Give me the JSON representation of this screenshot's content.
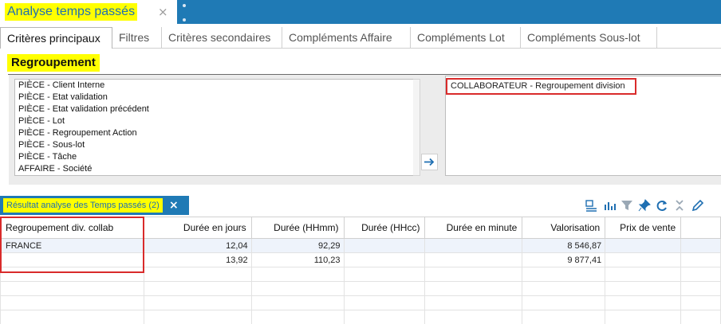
{
  "window": {
    "title": "Analyse temps passés",
    "close_glyph": "×"
  },
  "tabs": [
    {
      "label": "Critères principaux",
      "active": true
    },
    {
      "label": "Filtres"
    },
    {
      "label": "Critères secondaires"
    },
    {
      "label": "Compléments Affaire"
    },
    {
      "label": "Compléments Lot"
    },
    {
      "label": "Compléments Sous-lot"
    }
  ],
  "regroupement": {
    "title": "Regroupement",
    "available": [
      "PIÈCE - Client Interne",
      "PIÈCE - Etat validation",
      "PIÈCE - Etat validation précédent",
      "PIÈCE - Lot",
      "PIÈCE - Regroupement Action",
      "PIÈCE - Sous-lot",
      "PIÈCE - Tâche",
      "AFFAIRE - Société"
    ],
    "selected": [
      "COLLABORATEUR - Regroupement division"
    ],
    "move_button_icon": "arrow-right-icon"
  },
  "result": {
    "tab_label": "Résultat analyse des Temps passés (2)",
    "close_glyph": "×",
    "toolbar_icons": [
      "columns-icon",
      "chart-icon",
      "filter-icon",
      "pin-icon",
      "refresh-icon",
      "collapse-icon",
      "edit-icon"
    ],
    "columns": [
      "Regroupement div. collab",
      "Durée en jours",
      "Durée (HHmm)",
      "Durée (HHcc)",
      "Durée en minute",
      "Valorisation",
      "Prix de vente"
    ],
    "rows": [
      [
        "FRANCE",
        "12,04",
        "92,29",
        "",
        "",
        "8 546,87",
        ""
      ],
      [
        "",
        "13,92",
        "110,23",
        "",
        "",
        "9 877,41",
        ""
      ],
      [
        "",
        "",
        "",
        "",
        "",
        "",
        ""
      ],
      [
        "",
        "",
        "",
        "",
        "",
        "",
        ""
      ],
      [
        "",
        "",
        "",
        "",
        "",
        "",
        ""
      ],
      [
        "",
        "",
        "",
        "",
        "",
        "",
        ""
      ],
      [
        "",
        "",
        "",
        "",
        "",
        "",
        ""
      ]
    ]
  },
  "colors": {
    "brand_blue": "#1f7ab5",
    "highlight_yellow": "#ffff00",
    "annotation_red": "#d92b2b"
  }
}
